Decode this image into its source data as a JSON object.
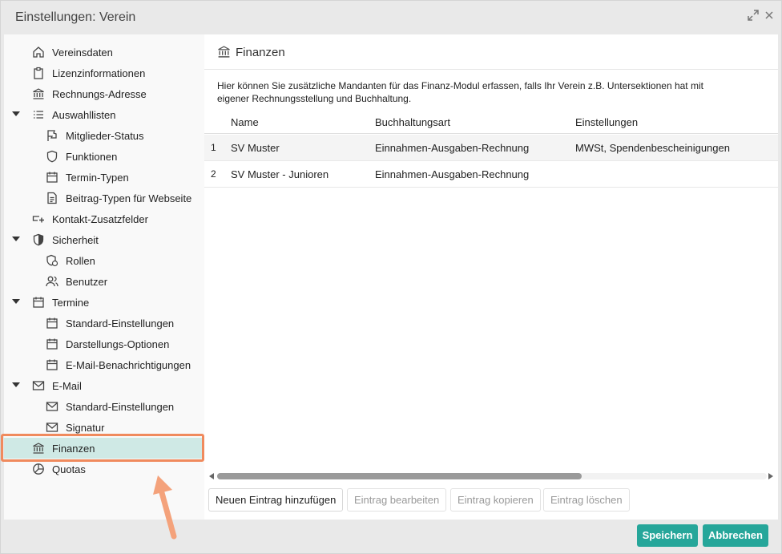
{
  "window": {
    "title": "Einstellungen: Verein"
  },
  "sidebar": {
    "items": [
      {
        "label": "Vereinsdaten",
        "icon": "home-icon"
      },
      {
        "label": "Lizenzinformationen",
        "icon": "clipboard-icon"
      },
      {
        "label": "Rechnungs-Adresse",
        "icon": "bank-icon"
      },
      {
        "label": "Auswahllisten",
        "icon": "list-icon"
      },
      {
        "label": "Mitglieder-Status",
        "icon": "flag-icon"
      },
      {
        "label": "Funktionen",
        "icon": "shield-outline-icon"
      },
      {
        "label": "Termin-Typen",
        "icon": "calendar-icon"
      },
      {
        "label": "Beitrag-Typen für Webseite",
        "icon": "document-icon"
      },
      {
        "label": "Kontakt-Zusatzfelder",
        "icon": "field-add-icon"
      },
      {
        "label": "Sicherheit",
        "icon": "shield-icon"
      },
      {
        "label": "Rollen",
        "icon": "role-shield-icon"
      },
      {
        "label": "Benutzer",
        "icon": "users-icon"
      },
      {
        "label": "Termine",
        "icon": "calendar-icon"
      },
      {
        "label": "Standard-Einstellungen",
        "icon": "calendar-icon"
      },
      {
        "label": "Darstellungs-Optionen",
        "icon": "calendar-icon"
      },
      {
        "label": "E-Mail-Benachrichtigungen",
        "icon": "calendar-icon"
      },
      {
        "label": "E-Mail",
        "icon": "mail-icon"
      },
      {
        "label": "Standard-Einstellungen",
        "icon": "mail-icon"
      },
      {
        "label": "Signatur",
        "icon": "mail-icon"
      },
      {
        "label": "Finanzen",
        "icon": "bank-icon"
      },
      {
        "label": "Quotas",
        "icon": "pie-icon"
      }
    ]
  },
  "main": {
    "title": "Finanzen",
    "description": "Hier können Sie zusätzliche Mandanten für das Finanz-Modul erfassen, falls Ihr Verein z.B. Untersektionen hat mit eigener Rechnungsstellung und Buchhaltung.",
    "columns": {
      "name": "Name",
      "buchhaltungsart": "Buchhaltungsart",
      "einstellungen": "Einstellungen"
    },
    "rows": [
      {
        "num": "1",
        "name": "SV Muster",
        "buchhaltungsart": "Einnahmen-Ausgaben-Rechnung",
        "einstellungen": "MWSt, Spendenbescheinigungen"
      },
      {
        "num": "2",
        "name": "SV Muster - Junioren",
        "buchhaltungsart": "Einnahmen-Ausgaben-Rechnung",
        "einstellungen": ""
      }
    ],
    "toolbar": {
      "new": "Neuen Eintrag hinzufügen",
      "edit": "Eintrag bearbeiten",
      "copy": "Eintrag kopieren",
      "delete": "Eintrag löschen"
    }
  },
  "footer": {
    "save": "Speichern",
    "cancel": "Abbrechen"
  },
  "colors": {
    "accent": "#26a69a",
    "selected": "#cfe9e5",
    "highlight": "#f08a5d"
  }
}
